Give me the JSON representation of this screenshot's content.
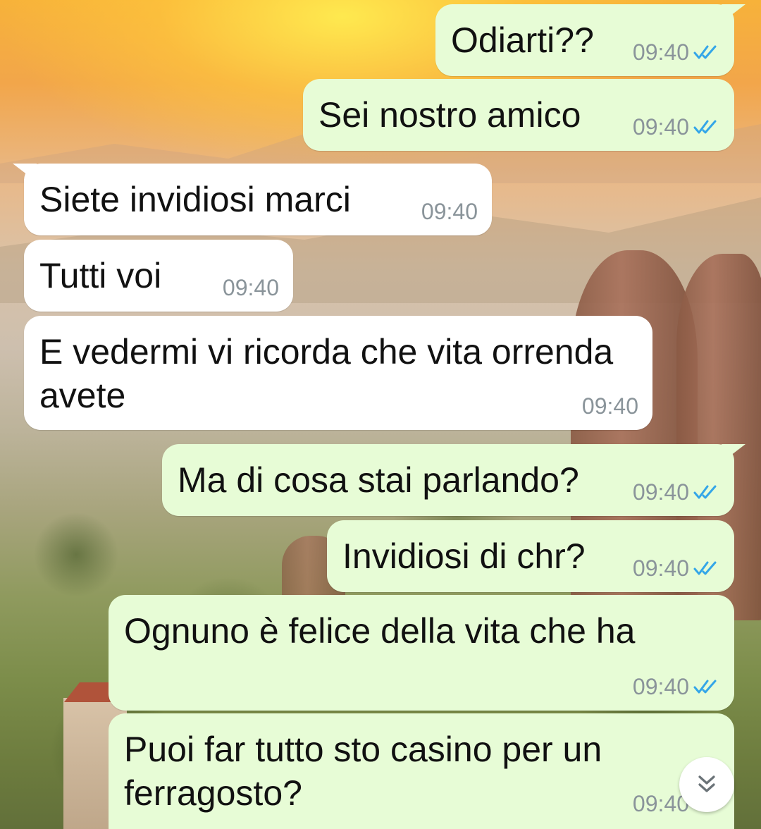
{
  "colors": {
    "outgoing_bubble": "#e7fcd6",
    "incoming_bubble": "#ffffff",
    "read_ticks": "#34a6e8",
    "timestamp": "#8a949a"
  },
  "messages": [
    {
      "direction": "outgoing",
      "text": "Odiarti??",
      "time": "09:40",
      "status": "read"
    },
    {
      "direction": "outgoing",
      "text": "Sei nostro amico",
      "time": "09:40",
      "status": "read"
    },
    {
      "direction": "incoming",
      "text": "Siete invidiosi marci",
      "time": "09:40"
    },
    {
      "direction": "incoming",
      "text": "Tutti voi",
      "time": "09:40"
    },
    {
      "direction": "incoming",
      "text": "E vedermi vi ricorda che vita orrenda\navete",
      "time": "09:40"
    },
    {
      "direction": "outgoing",
      "text": "Ma di cosa stai parlando?",
      "time": "09:40",
      "status": "read"
    },
    {
      "direction": "outgoing",
      "text": "Invidiosi di chr?",
      "time": "09:40",
      "status": "read"
    },
    {
      "direction": "outgoing",
      "text": "Ognuno è felice della vita che ha",
      "time": "09:40",
      "status": "read"
    },
    {
      "direction": "outgoing",
      "text": "Puoi far tutto sto casino per un\nferragosto?",
      "time": "09:40",
      "status": "read"
    }
  ],
  "scroll_button": {
    "icon": "double-chevron-down-icon"
  }
}
